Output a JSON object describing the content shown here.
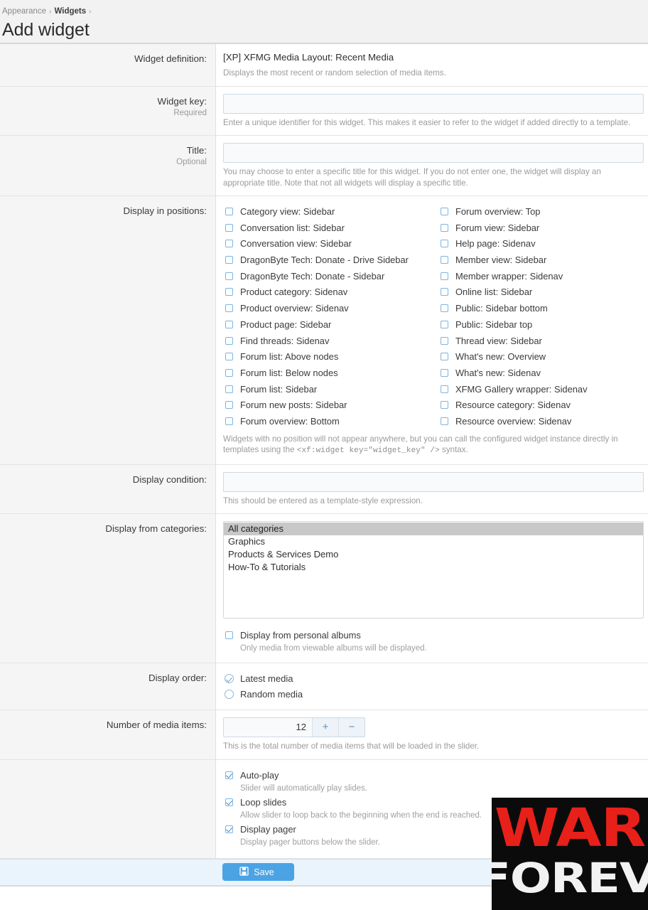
{
  "header": {
    "breadcrumb": [
      {
        "label": "Appearance",
        "strong": false
      },
      {
        "label": "Widgets",
        "strong": true
      }
    ],
    "separator": "›",
    "title": "Add widget"
  },
  "form": {
    "definition": {
      "label": "Widget definition:",
      "name": "[XP] XFMG Media Layout: Recent Media",
      "description": "Displays the most recent or random selection of media items."
    },
    "widget_key": {
      "label": "Widget key:",
      "requirement": "Required",
      "value": "",
      "placeholder": "",
      "explain": "Enter a unique identifier for this widget. This makes it easier to refer to the widget if added directly to a template."
    },
    "title": {
      "label": "Title:",
      "requirement": "Optional",
      "value": "",
      "placeholder": "",
      "explain": "You may choose to enter a specific title for this widget. If you do not enter one, the widget will display an appropriate title. Note that not all widgets will display a specific title."
    },
    "positions": {
      "label": "Display in positions:",
      "left_column": [
        {
          "label": "Category view: Sidebar",
          "checked": false
        },
        {
          "label": "Conversation list: Sidebar",
          "checked": false
        },
        {
          "label": "Conversation view: Sidebar",
          "checked": false
        },
        {
          "label": "DragonByte Tech: Donate - Drive Sidebar",
          "checked": false
        },
        {
          "label": "DragonByte Tech: Donate - Sidebar",
          "checked": false
        },
        {
          "label": "Product category: Sidenav",
          "checked": false
        },
        {
          "label": "Product overview: Sidenav",
          "checked": false
        },
        {
          "label": "Product page: Sidebar",
          "checked": false
        },
        {
          "label": "Find threads: Sidenav",
          "checked": false
        },
        {
          "label": "Forum list: Above nodes",
          "checked": false
        },
        {
          "label": "Forum list: Below nodes",
          "checked": false
        },
        {
          "label": "Forum list: Sidebar",
          "checked": false
        },
        {
          "label": "Forum new posts: Sidebar",
          "checked": false
        },
        {
          "label": "Forum overview: Bottom",
          "checked": false
        }
      ],
      "right_column": [
        {
          "label": "Forum overview: Top",
          "checked": false
        },
        {
          "label": "Forum view: Sidebar",
          "checked": false
        },
        {
          "label": "Help page: Sidenav",
          "checked": false
        },
        {
          "label": "Member view: Sidebar",
          "checked": false
        },
        {
          "label": "Member wrapper: Sidenav",
          "checked": false
        },
        {
          "label": "Online list: Sidebar",
          "checked": false
        },
        {
          "label": "Public: Sidebar bottom",
          "checked": false
        },
        {
          "label": "Public: Sidebar top",
          "checked": false
        },
        {
          "label": "Thread view: Sidebar",
          "checked": false
        },
        {
          "label": "What's new: Overview",
          "checked": false
        },
        {
          "label": "What's new: Sidenav",
          "checked": false
        },
        {
          "label": "XFMG Gallery wrapper: Sidenav",
          "checked": false
        },
        {
          "label": "Resource category: Sidenav",
          "checked": false
        },
        {
          "label": "Resource overview: Sidenav",
          "checked": false
        }
      ],
      "explain_before_code": "Widgets with no position will not appear anywhere, but you can call the configured widget instance directly in templates using the ",
      "explain_code": "<xf:widget key=\"widget_key\" />",
      "explain_after_code": " syntax."
    },
    "display_condition": {
      "label": "Display condition:",
      "value": "",
      "placeholder": "",
      "explain": "This should be entered as a template-style expression."
    },
    "categories": {
      "label": "Display from categories:",
      "options": [
        {
          "label": "All categories",
          "selected": true
        },
        {
          "label": "Graphics",
          "selected": false
        },
        {
          "label": "Products & Services Demo",
          "selected": false
        },
        {
          "label": "How-To & Tutorials",
          "selected": false
        }
      ]
    },
    "personal_albums": {
      "label": "Display from personal albums",
      "checked": false,
      "description": "Only media from viewable albums will be displayed."
    },
    "display_order": {
      "label": "Display order:",
      "options": [
        {
          "label": "Latest media",
          "selected": true
        },
        {
          "label": "Random media",
          "selected": false
        }
      ]
    },
    "media_count": {
      "label": "Number of media items:",
      "value": "12",
      "increment": "+",
      "decrement": "−",
      "explain": "This is the total number of media items that will be loaded in the slider."
    },
    "slider_options": [
      {
        "label": "Auto-play",
        "checked": true,
        "description": "Slider will automatically play slides."
      },
      {
        "label": "Loop slides",
        "checked": true,
        "description": "Allow slider to loop back to the beginning when the end is reached."
      },
      {
        "label": "Display pager",
        "checked": true,
        "description": "Display pager buttons below the slider."
      }
    ],
    "footer": {
      "save_label": "Save",
      "save_icon": "save-disk-icon"
    }
  },
  "overlay": {
    "banner_top": "WAR",
    "banner_bottom": "FOREVER",
    "colors": {
      "top": "#E8201A",
      "bottom": "#F2F2F2",
      "bg": "#0B0B0B"
    }
  },
  "colors": {
    "accent": "#4BA3E3",
    "label_bg": "#F5F5F5",
    "header_bg": "#F2F2F2",
    "footer_bg": "#EAF4FC",
    "list_selected": "#C8C8C8"
  }
}
